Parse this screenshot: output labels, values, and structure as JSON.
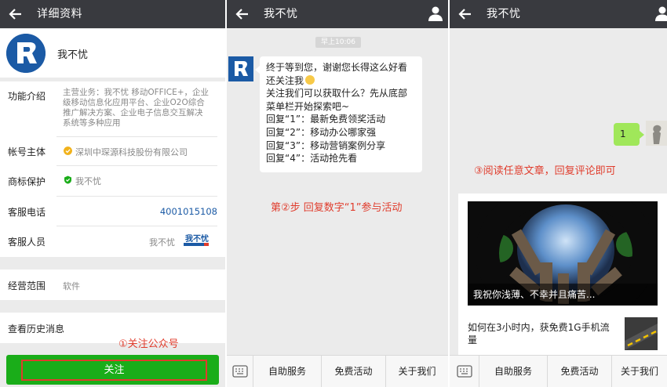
{
  "panel1": {
    "title": "详细资料",
    "account_name": "我不忧",
    "rows": {
      "intro_label": "功能介绍",
      "intro_lines": [
        "主营业务：我不忧 移动OFFICE+，企业",
        "级移动信息化应用平台、企业O2O综合",
        "推广解决方案、企业电子信息交互解决",
        "系统等多种应用"
      ],
      "owner_label": "帐号主体",
      "owner_value": "深圳中琛源科技股份有限公司",
      "trademark_label": "商标保护",
      "trademark_value": "我不忧",
      "phone_label": "客服电话",
      "phone_value": "4001015108",
      "staff_label": "客服人员",
      "staff_value": "我不忧",
      "staff_logo_text": "我不忧",
      "scope_label": "经营范围",
      "scope_value": "软件",
      "history_label": "查看历史消息"
    },
    "follow_note": "①关注公众号",
    "follow_button": "关注"
  },
  "panel2": {
    "title": "我不忧",
    "time": "早上10:06",
    "message_lines": [
      "终于等到您，谢谢您长得这么好看",
      "还关注我",
      "关注我们可以获取什么？先从底部",
      "菜单栏开始探索吧~",
      "回复“1”：最新免费领奖活动",
      "回复“2”：移动办公哪家强",
      "回复“3”：移动营销案例分享",
      "回复“4”：活动抢先看"
    ],
    "step_note": "第②步 回复数字“1”参与活动",
    "menu": [
      "自助服务",
      "免费活动",
      "关于我们"
    ]
  },
  "panel3": {
    "title": "我不忧",
    "my_reply": "1",
    "note": "③阅读任意文章，回复评论即可",
    "cover_caption": "我祝你浅薄、不幸并且痛苦...",
    "sub_article": "如何在3小时内，获免费1G手机流量",
    "menu": [
      "自助服务",
      "免费活动",
      "关于我们"
    ]
  },
  "colors": {
    "titlebar": "#393a3f",
    "follow_green": "#1aad19",
    "annotation_red": "#e03c2c",
    "my_bubble": "#a0e75a",
    "brand_blue": "#1b5aa5"
  },
  "icons": [
    "back-arrow-icon",
    "person-icon",
    "keyboard-icon",
    "verified-badge-icon",
    "trademark-icon",
    "smile-emoji-icon"
  ]
}
